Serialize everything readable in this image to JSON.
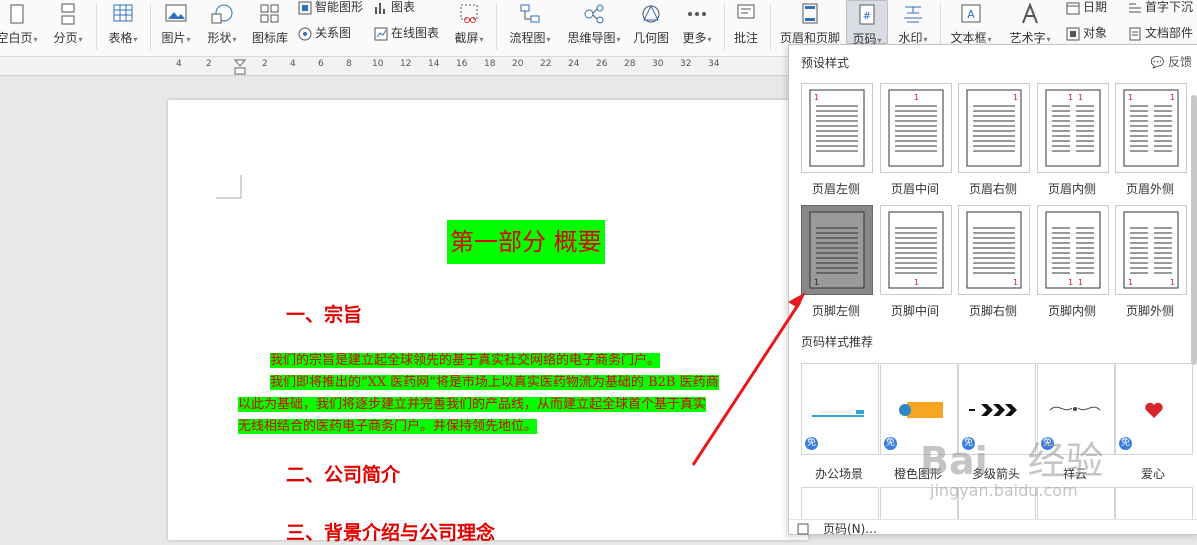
{
  "ribbon": {
    "blank_page": "空白页",
    "page_break": "分页",
    "table": "表格",
    "picture": "图片",
    "shape": "形状",
    "icon_library": "图标库",
    "smart_shape": "智能图形",
    "chart": "图表",
    "relation_graph": "关系图",
    "online_chart": "在线图表",
    "screenshot": "截屏",
    "flowchart": "流程图",
    "mindmap": "思维导图",
    "geometry": "几何图",
    "more": "更多",
    "comment": "批注",
    "header_footer": "页眉和页脚",
    "page_number": "页码",
    "watermark": "水印",
    "textbox": "文本框",
    "wordart": "艺术字",
    "date": "日期",
    "object": "对象",
    "drop_cap": "首字下沉",
    "doc_parts": "文档部件"
  },
  "ruler": {
    "numbers": [
      "4",
      "2",
      "2",
      "4",
      "6",
      "8",
      "10",
      "12",
      "14",
      "16",
      "18",
      "20",
      "22",
      "24",
      "26",
      "28",
      "30",
      "32",
      "34"
    ]
  },
  "document": {
    "title": "第一部分  概要",
    "heading1": "一、宗旨",
    "para1": "我们的宗旨是建立起全球领先的基于真实社交网络的电子商务门户。",
    "para2": "我们即将推出的“XX 医药网”将是市场上以真实医药物流为基础的 B2B 医药商",
    "para3": "以此为基础，我们将逐步建立并完善我们的产品线，从而建立起全球首个基于真实",
    "para4": "无线相结合的医药电子商务门户。并保持领先地位。",
    "heading2": "二、公司简介",
    "heading3": "三、背景介绍与公司理念"
  },
  "panel": {
    "preset_title": "预设样式",
    "feedback": "反馈",
    "presets": [
      {
        "label": "页眉左侧",
        "pos": "header-left"
      },
      {
        "label": "页眉中间",
        "pos": "header-center"
      },
      {
        "label": "页眉右侧",
        "pos": "header-right"
      },
      {
        "label": "页眉内侧",
        "pos": "header-inner"
      },
      {
        "label": "页眉外侧",
        "pos": "header-outer"
      },
      {
        "label": "页脚左侧",
        "pos": "footer-left"
      },
      {
        "label": "页脚中间",
        "pos": "footer-center"
      },
      {
        "label": "页脚右侧",
        "pos": "footer-right"
      },
      {
        "label": "页脚内侧",
        "pos": "footer-inner"
      },
      {
        "label": "页脚外侧",
        "pos": "footer-outer"
      }
    ],
    "thumb_number": "1",
    "recommend_title": "页码样式推荐",
    "recommend": [
      "办公场景",
      "橙色图形",
      "多级箭头",
      "祥云",
      "爱心"
    ],
    "free_badge": "免",
    "footer_item": "页码(N)..."
  },
  "watermark_text": {
    "brand": "Bai",
    "brand2": "经验",
    "url": "jingyan.baidu.com"
  },
  "colors": {
    "highlight": "#00ff00",
    "text_red": "#e00000",
    "arrow": "#e8191d"
  }
}
